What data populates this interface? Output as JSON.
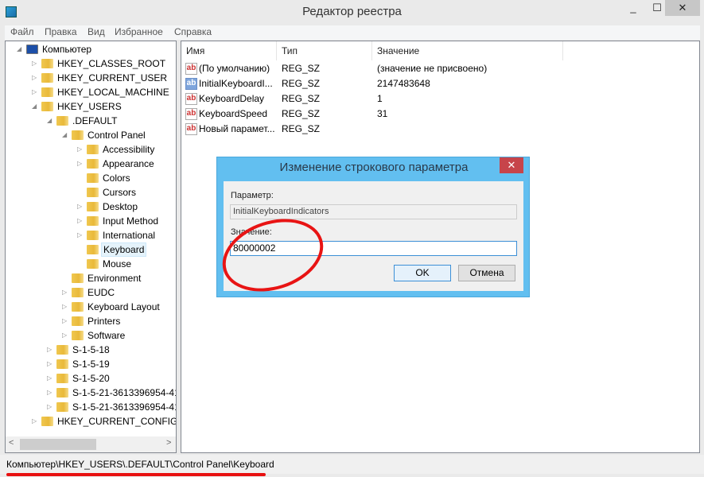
{
  "window": {
    "title": "Редактор реестра",
    "app_icon": "regedit-icon",
    "controls": {
      "minimize": "_",
      "maximize": "☐",
      "close": "✕"
    }
  },
  "menu": [
    "Файл",
    "Правка",
    "Вид",
    "Избранное",
    "Справка"
  ],
  "tree": [
    {
      "label": "Компьютер",
      "level": 0,
      "state": "expanded",
      "icon": "computer-icon"
    },
    {
      "label": "HKEY_CLASSES_ROOT",
      "level": 1,
      "state": "collapsed"
    },
    {
      "label": "HKEY_CURRENT_USER",
      "level": 1,
      "state": "collapsed"
    },
    {
      "label": "HKEY_LOCAL_MACHINE",
      "level": 1,
      "state": "collapsed"
    },
    {
      "label": "HKEY_USERS",
      "level": 1,
      "state": "expanded"
    },
    {
      "label": ".DEFAULT",
      "level": 2,
      "state": "expanded"
    },
    {
      "label": "Control Panel",
      "level": 3,
      "state": "expanded"
    },
    {
      "label": "Accessibility",
      "level": 4,
      "state": "collapsed"
    },
    {
      "label": "Appearance",
      "level": 4,
      "state": "collapsed"
    },
    {
      "label": "Colors",
      "level": 4,
      "state": "none"
    },
    {
      "label": "Cursors",
      "level": 4,
      "state": "none"
    },
    {
      "label": "Desktop",
      "level": 4,
      "state": "collapsed"
    },
    {
      "label": "Input Method",
      "level": 4,
      "state": "collapsed"
    },
    {
      "label": "International",
      "level": 4,
      "state": "collapsed"
    },
    {
      "label": "Keyboard",
      "level": 4,
      "state": "none",
      "selected": true
    },
    {
      "label": "Mouse",
      "level": 4,
      "state": "none"
    },
    {
      "label": "Environment",
      "level": 3,
      "state": "none"
    },
    {
      "label": "EUDC",
      "level": 3,
      "state": "collapsed"
    },
    {
      "label": "Keyboard Layout",
      "level": 3,
      "state": "collapsed"
    },
    {
      "label": "Printers",
      "level": 3,
      "state": "collapsed"
    },
    {
      "label": "Software",
      "level": 3,
      "state": "collapsed"
    },
    {
      "label": "S-1-5-18",
      "level": 2,
      "state": "collapsed"
    },
    {
      "label": "S-1-5-19",
      "level": 2,
      "state": "collapsed"
    },
    {
      "label": "S-1-5-20",
      "level": 2,
      "state": "collapsed"
    },
    {
      "label": "S-1-5-21-3613396954-418",
      "level": 2,
      "state": "collapsed"
    },
    {
      "label": "S-1-5-21-3613396954-418",
      "level": 2,
      "state": "collapsed"
    },
    {
      "label": "HKEY_CURRENT_CONFIG",
      "level": 1,
      "state": "collapsed"
    }
  ],
  "values": {
    "columns": [
      "Имя",
      "Тип",
      "Значение"
    ],
    "rows": [
      {
        "name": "(По умолчанию)",
        "type": "REG_SZ",
        "data": "(значение не присвоено)"
      },
      {
        "name": "InitialKeyboardI...",
        "type": "REG_SZ",
        "data": "2147483648",
        "selected": true
      },
      {
        "name": "KeyboardDelay",
        "type": "REG_SZ",
        "data": "1"
      },
      {
        "name": "KeyboardSpeed",
        "type": "REG_SZ",
        "data": "31"
      },
      {
        "name": "Новый парамет...",
        "type": "REG_SZ",
        "data": ""
      }
    ]
  },
  "status": "Компьютер\\HKEY_USERS\\.DEFAULT\\Control Panel\\Keyboard",
  "dialog": {
    "title": "Изменение строкового параметра",
    "close": "✕",
    "param_label": "Параметр:",
    "param_value": "InitialKeyboardIndicators",
    "value_label": "Значение:",
    "value_value": "80000002",
    "ok": "OK",
    "cancel": "Отмена"
  },
  "colors": {
    "dialog_title": "#62bff0",
    "annotation": "#e81414"
  }
}
